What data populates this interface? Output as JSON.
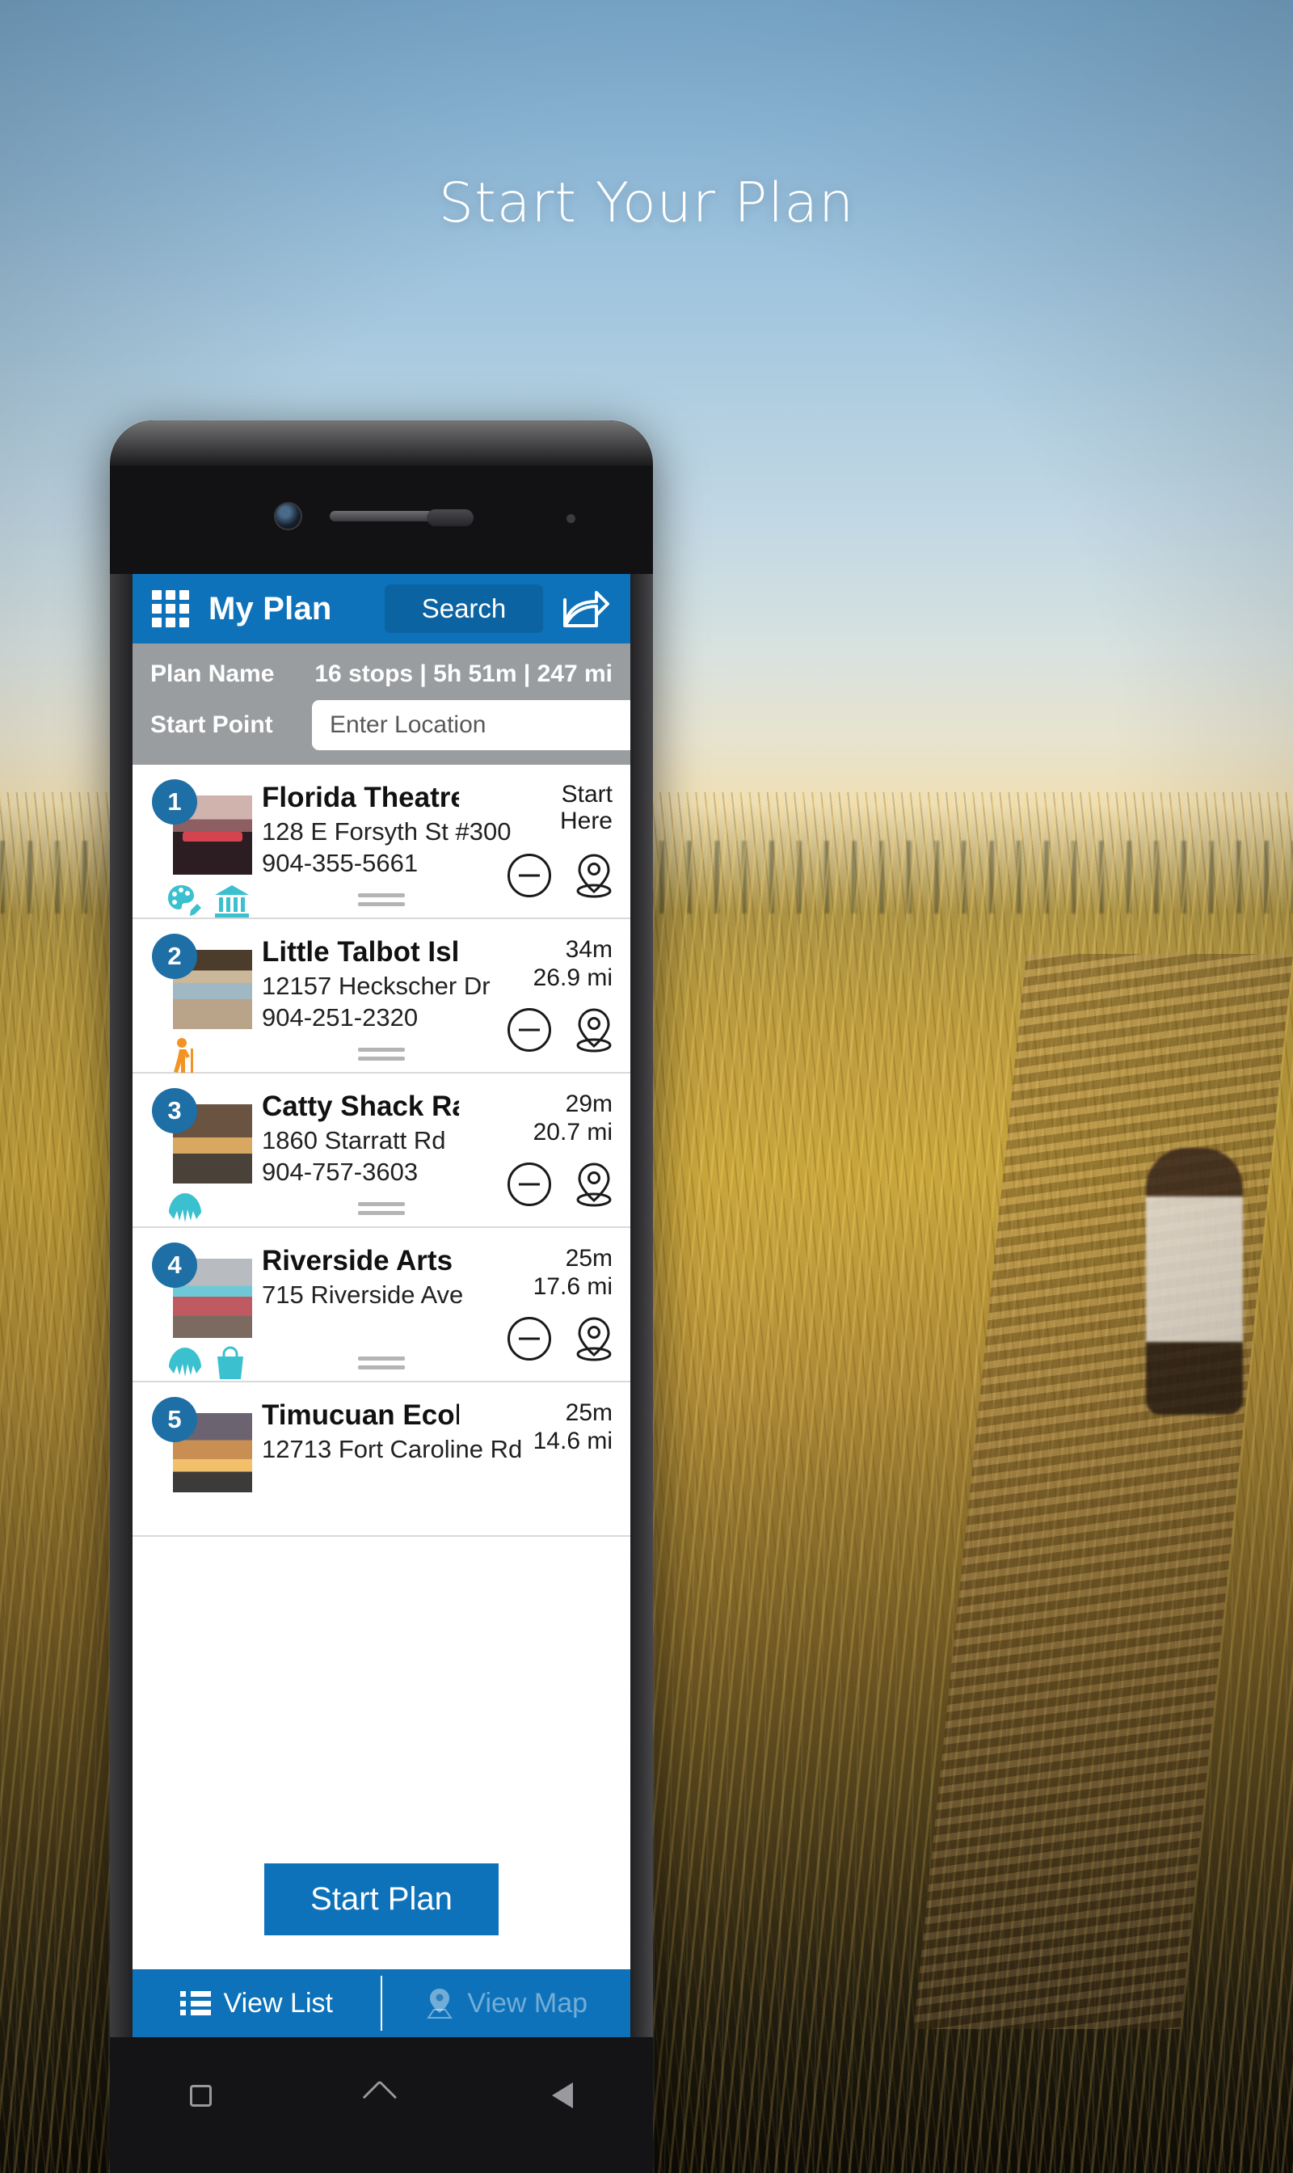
{
  "headline": "Start Your Plan",
  "appbar": {
    "grid_icon": "grid-icon",
    "title": "My Plan",
    "search_label": "Search",
    "share_icon": "share-icon"
  },
  "planbar": {
    "plan_name_label": "Plan Name",
    "stats": "16 stops | 5h 51m | 247 mi",
    "start_point_label": "Start Point",
    "start_point_value": "",
    "start_point_placeholder": "Enter Location"
  },
  "rows": [
    {
      "number": "1",
      "title": "Florida Theatre",
      "address": "128 E Forsyth St #300",
      "phone": "904-355-5661",
      "time": "Start",
      "distance": "Here",
      "icons": [
        "art-palette-icon",
        "museum-icon"
      ],
      "thumb": "florida-theatre-thumbnail"
    },
    {
      "number": "2",
      "title": "Little Talbot Island State Park",
      "address": "12157 Heckscher Dr",
      "phone": "904-251-2320",
      "time": "34m",
      "distance": "26.9 mi",
      "icons": [
        "hiker-icon"
      ],
      "thumb": "little-talbot-island-thumbnail"
    },
    {
      "number": "3",
      "title": "Catty Shack Ranch Wildlife Sa...",
      "address": "1860 Starratt Rd",
      "phone": "904-757-3603",
      "time": "29m",
      "distance": "20.7 mi",
      "icons": [
        "shell-icon"
      ],
      "thumb": "catty-shack-ranch-thumbnail"
    },
    {
      "number": "4",
      "title": "Riverside Arts Market (RAM)",
      "address": "715 Riverside Ave",
      "phone": "",
      "time": "25m",
      "distance": "17.6 mi",
      "icons": [
        "shell-icon",
        "shopping-bag-icon"
      ],
      "thumb": "riverside-arts-market-thumbnail"
    },
    {
      "number": "5",
      "title": "Timucuan Ecological & Histori...",
      "address": "12713 Fort Caroline Rd",
      "phone": "",
      "time": "25m",
      "distance": "14.6 mi",
      "icons": [],
      "thumb": "timucuan-preserve-thumbnail"
    }
  ],
  "start_plan_button": "Start Plan",
  "bottom_tabs": {
    "view_list": "View List",
    "view_map": "View Map"
  },
  "colors": {
    "app_blue": "#0d72ba",
    "badge_blue": "#1d6fa5",
    "plan_bar_gray": "#9a9da0",
    "category_teal": "#3bc0cf",
    "hiker_orange": "#f39324"
  }
}
